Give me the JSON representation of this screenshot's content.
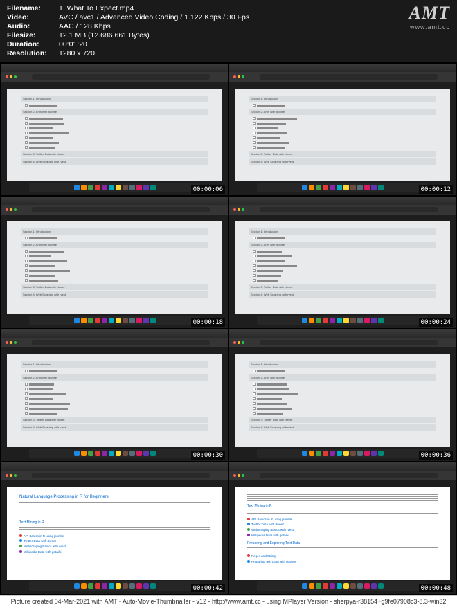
{
  "header": {
    "filename_label": "Filename:",
    "filename_value": "1. What To Expect.mp4",
    "video_label": "Video:",
    "video_value": "AVC / avc1 / Advanced Video Coding / 1.122 Kbps / 30 Fps",
    "audio_label": "Audio:",
    "audio_value": "AAC / 128 Kbps",
    "filesize_label": "Filesize:",
    "filesize_value": "12.1 MB (12.686.661 Bytes)",
    "duration_label": "Duration:",
    "duration_value": "00:01:20",
    "resolution_label": "Resolution:",
    "resolution_value": "1280 x 720"
  },
  "logo": {
    "main": "AMT",
    "sub": "www.amt.cc"
  },
  "thumbs": [
    {
      "ts": "00:00:06",
      "type": "course"
    },
    {
      "ts": "00:00:12",
      "type": "course"
    },
    {
      "ts": "00:00:18",
      "type": "course"
    },
    {
      "ts": "00:00:24",
      "type": "course"
    },
    {
      "ts": "00:00:30",
      "type": "course"
    },
    {
      "ts": "00:00:36",
      "type": "course"
    },
    {
      "ts": "00:00:42",
      "type": "doc1"
    },
    {
      "ts": "00:00:48",
      "type": "doc2"
    }
  ],
  "course": {
    "section1": "Section 1: Introduction",
    "item1": "1 What To Expect",
    "section2": "Section 2: APIs with jsonlite",
    "section3": "Section 3: Twitter Data with rtweet",
    "section4": "Section 4: Web Scraping with rvest"
  },
  "doc1": {
    "title": "Natural Language Processing in R for Beginners",
    "h2a": "Text Mining in R",
    "links": [
      "API Basics in R using jsonlite",
      "Twitter Data with rtweet",
      "Webscraping Basics with rvest",
      "Wikipedia Data with getwiki"
    ]
  },
  "doc2": {
    "h2a": "Text Mining in R",
    "h2b": "Preparing and Exploring Text Data",
    "links1": [
      "API Basics in R using jsonlite",
      "Twitter Data with rtweet",
      "Webscraping Basics with rvest",
      "Wikipedia Data with getwiki"
    ],
    "links2": [
      "Regex and Stringr",
      "Preparing Text Data with tidytext"
    ]
  },
  "footer": "Picture created 04-Mar-2021 with AMT - Auto-Movie-Thumbnailer - v12 - http://www.amt.cc - using MPlayer Version - sherpya-r38154+g9fe07908c3-8.3-win32"
}
